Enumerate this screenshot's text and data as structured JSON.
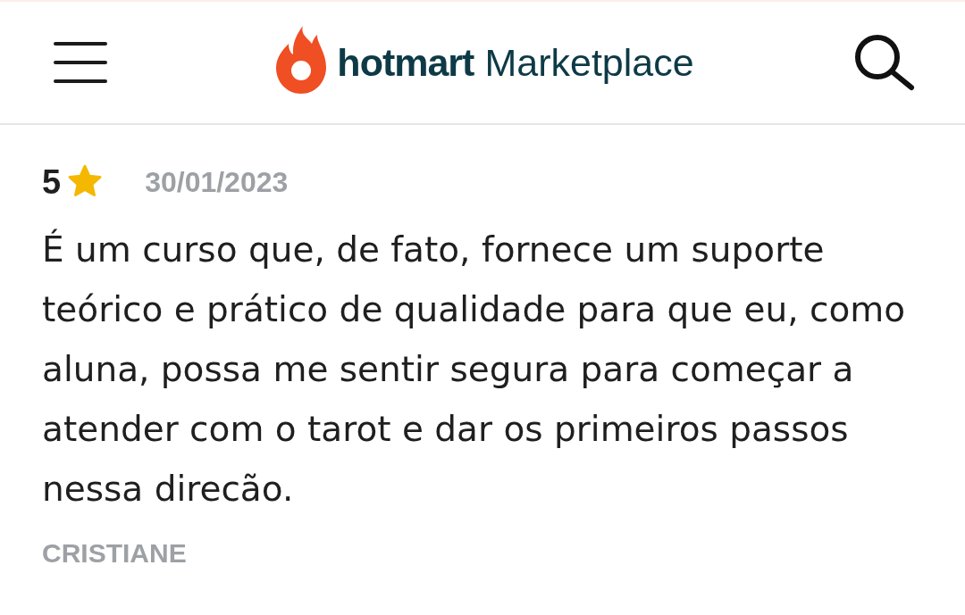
{
  "header": {
    "brand": "hotmart",
    "product": "Marketplace"
  },
  "review": {
    "rating": "5",
    "date": "30/01/2023",
    "text": "É um curso que, de fato, fornece um suporte teórico e prático de qualidade para que eu, como aluna, possa me sentir segura para começar a atender com o tarot e dar os primeiros passos nessa direcão.",
    "author": "CRISTIANE"
  }
}
